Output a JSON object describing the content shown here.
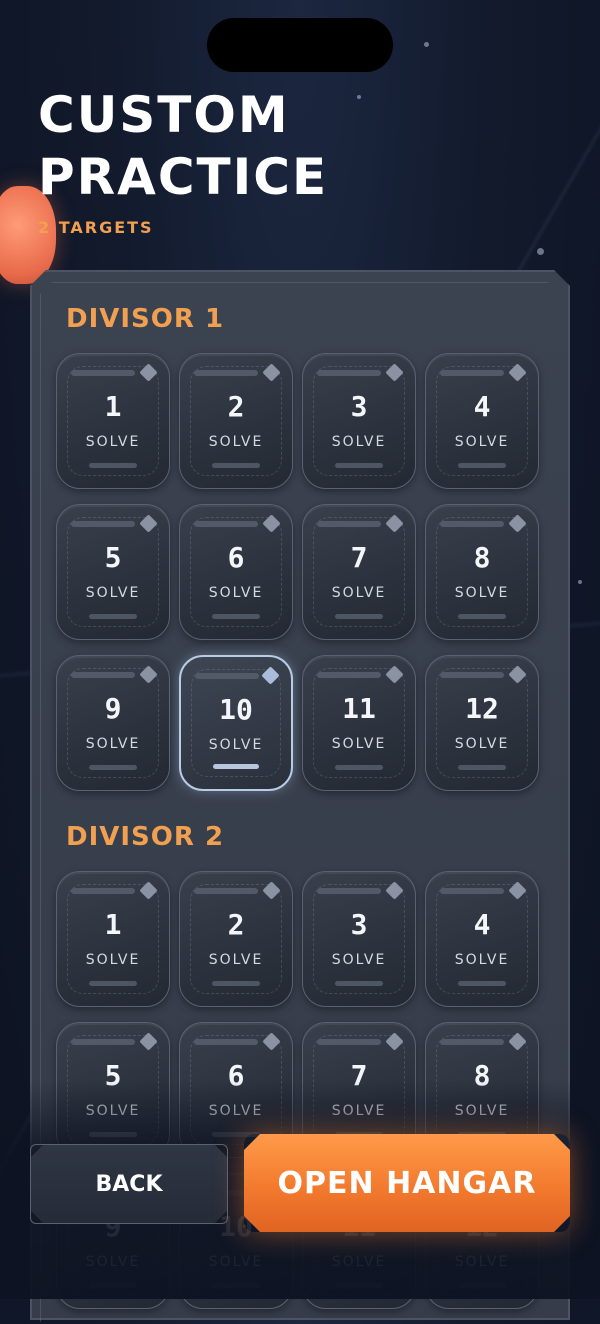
{
  "header": {
    "title_line1": "CUSTOM",
    "title_line2": "PRACTICE",
    "subtitle": "2 TARGETS"
  },
  "sections": [
    {
      "title": "DIVISOR 1",
      "tiles": [
        {
          "number": "1",
          "label": "SOLVE",
          "selected": false
        },
        {
          "number": "2",
          "label": "SOLVE",
          "selected": false
        },
        {
          "number": "3",
          "label": "SOLVE",
          "selected": false
        },
        {
          "number": "4",
          "label": "SOLVE",
          "selected": false
        },
        {
          "number": "5",
          "label": "SOLVE",
          "selected": false
        },
        {
          "number": "6",
          "label": "SOLVE",
          "selected": false
        },
        {
          "number": "7",
          "label": "SOLVE",
          "selected": false
        },
        {
          "number": "8",
          "label": "SOLVE",
          "selected": false
        },
        {
          "number": "9",
          "label": "SOLVE",
          "selected": false
        },
        {
          "number": "10",
          "label": "SOLVE",
          "selected": true
        },
        {
          "number": "11",
          "label": "SOLVE",
          "selected": false
        },
        {
          "number": "12",
          "label": "SOLVE",
          "selected": false
        }
      ]
    },
    {
      "title": "DIVISOR 2",
      "tiles": [
        {
          "number": "1",
          "label": "SOLVE",
          "selected": false
        },
        {
          "number": "2",
          "label": "SOLVE",
          "selected": false
        },
        {
          "number": "3",
          "label": "SOLVE",
          "selected": false
        },
        {
          "number": "4",
          "label": "SOLVE",
          "selected": false
        },
        {
          "number": "5",
          "label": "SOLVE",
          "selected": false
        },
        {
          "number": "6",
          "label": "SOLVE",
          "selected": false
        },
        {
          "number": "7",
          "label": "SOLVE",
          "selected": false
        },
        {
          "number": "8",
          "label": "SOLVE",
          "selected": false
        },
        {
          "number": "9",
          "label": "SOLVE",
          "selected": false
        },
        {
          "number": "10",
          "label": "SOLVE",
          "selected": false
        },
        {
          "number": "11",
          "label": "SOLVE",
          "selected": false
        },
        {
          "number": "12",
          "label": "SOLVE",
          "selected": false
        }
      ]
    }
  ],
  "footer": {
    "back_label": "BACK",
    "primary_label": "OPEN HANGAR"
  },
  "colors": {
    "accent": "#f0a050",
    "primary_button": "#f27a2e",
    "panel": "#3b4250",
    "selected_border": "#b8cce6"
  },
  "icons": {
    "tile_corner": "diamond-icon"
  }
}
